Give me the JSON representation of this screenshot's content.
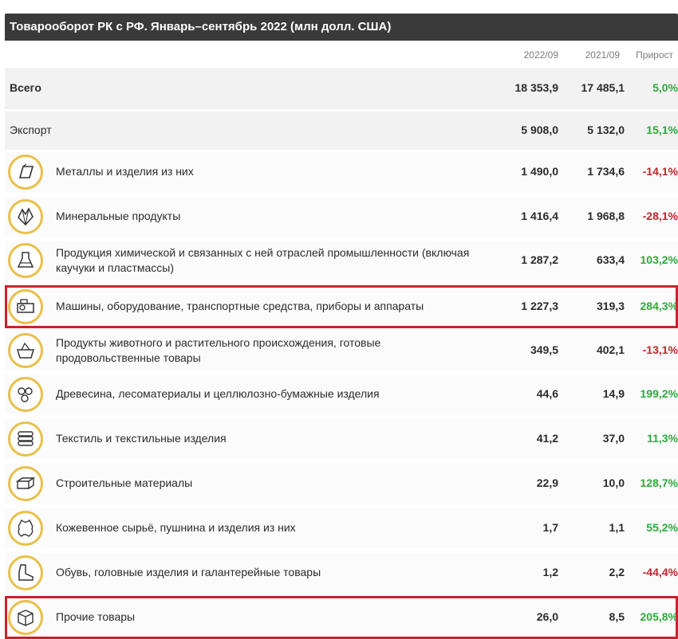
{
  "title": "Товарооборот РК с РФ. Январь–сентябрь 2022 (млн долл. США)",
  "columns": [
    "2022/09",
    "2021/09",
    "Прирост"
  ],
  "summary_rows": [
    {
      "label": "Всего",
      "v2022": "18 353,9",
      "v2021": "17 485,1",
      "growth": "5,0%"
    },
    {
      "label": "Экспорт",
      "v2022": "5 908,0",
      "v2021": "5 132,0",
      "growth": "15,1%"
    }
  ],
  "category_rows": [
    {
      "icon": "metal-bar-icon",
      "label": "Металлы и изделия из них",
      "label2": "",
      "v2022": "1 490,0",
      "v2021": "1 734,6",
      "growth": "-14,1%"
    },
    {
      "icon": "mineral-crystal-icon",
      "label": "Минеральные продукты",
      "label2": "",
      "v2022": "1 416,4",
      "v2021": "1 968,8",
      "growth": "-28,1%"
    },
    {
      "icon": "chemistry-flask-icon",
      "label": "Продукция химической и связанных с ней отраслей промышленности (включая",
      "label2": "каучуки и пластмассы)",
      "v2022": "1 287,2",
      "v2021": "633,4",
      "growth": "103,2%"
    },
    {
      "icon": "machinery-icon",
      "label": "Машины, оборудование, транспортные средства, приборы и аппараты",
      "label2": "",
      "v2022": "1 227,3",
      "v2021": "319,3",
      "growth": "284,3%"
    },
    {
      "icon": "food-basket-icon",
      "label": "Продукты животного и растительного происхождения, готовые",
      "label2": "продовольственные товары",
      "v2022": "349,5",
      "v2021": "402,1",
      "growth": "-13,1%"
    },
    {
      "icon": "wood-logs-icon",
      "label": "Древесина, лесоматериалы и целлюлозно-бумажные изделия",
      "label2": "",
      "v2022": "44,6",
      "v2021": "14,9",
      "growth": "199,2%"
    },
    {
      "icon": "textile-stack-icon",
      "label": "Текстиль и текстильные изделия",
      "label2": "",
      "v2022": "41,2",
      "v2021": "37,0",
      "growth": "11,3%"
    },
    {
      "icon": "brick-icon",
      "label": "Строительные материалы",
      "label2": "",
      "v2022": "22,9",
      "v2021": "10,0",
      "growth": "128,7%"
    },
    {
      "icon": "leather-hide-icon",
      "label": "Кожевенное сырьё, пушнина и изделия из них",
      "label2": "",
      "v2022": "1,7",
      "v2021": "1,1",
      "growth": "55,2%"
    },
    {
      "icon": "boot-icon",
      "label": "Обувь, головные изделия и галантерейные товары",
      "label2": "",
      "v2022": "1,2",
      "v2021": "2,2",
      "growth": "-44,4%"
    },
    {
      "icon": "box-icon",
      "label": "Прочие товары",
      "label2": "",
      "v2022": "26,0",
      "v2021": "8,5",
      "growth": "205,8%"
    }
  ],
  "colors": {
    "header_bg": "#3a3a3a",
    "positive": "#2eaa3b",
    "negative": "#c0262d",
    "icon_ring": "#e9c04a",
    "highlight": "#c8232c"
  },
  "chart_data": {
    "type": "table",
    "title": "Товарооборот РК с РФ. Январь–сентябрь 2022 (млн долл. США)",
    "columns": [
      "2022/09",
      "2021/09",
      "Прирост"
    ],
    "rows": [
      [
        "Всего",
        18353.9,
        17485.1,
        5.0
      ],
      [
        "Экспорт",
        5908.0,
        5132.0,
        15.1
      ],
      [
        "Металлы и изделия из них",
        1490.0,
        1734.6,
        -14.1
      ],
      [
        "Минеральные продукты",
        1416.4,
        1968.8,
        -28.1
      ],
      [
        "Продукция химической и связанных с ней отраслей промышленности (включая каучуки и пластмассы)",
        1287.2,
        633.4,
        103.2
      ],
      [
        "Машины, оборудование, транспортные средства, приборы и аппараты",
        1227.3,
        319.3,
        284.3
      ],
      [
        "Продукты животного и растительного происхождения, готовые продовольственные товары",
        349.5,
        402.1,
        -13.1
      ],
      [
        "Древесина, лесоматериалы и целлюлозно-бумажные изделия",
        44.6,
        14.9,
        199.2
      ],
      [
        "Текстиль и текстильные изделия",
        41.2,
        37.0,
        11.3
      ],
      [
        "Строительные материалы",
        22.9,
        10.0,
        128.7
      ],
      [
        "Кожевенное сырьё, пушнина и изделия из них",
        1.7,
        1.1,
        55.2
      ],
      [
        "Обувь, головные изделия и галантерейные товары",
        1.2,
        2.2,
        -44.4
      ],
      [
        "Прочие товары",
        26.0,
        8.5,
        205.8
      ]
    ],
    "highlighted_rows": [
      "Машины, оборудование, транспортные средства, приборы и аппараты",
      "Прочие товары"
    ]
  }
}
